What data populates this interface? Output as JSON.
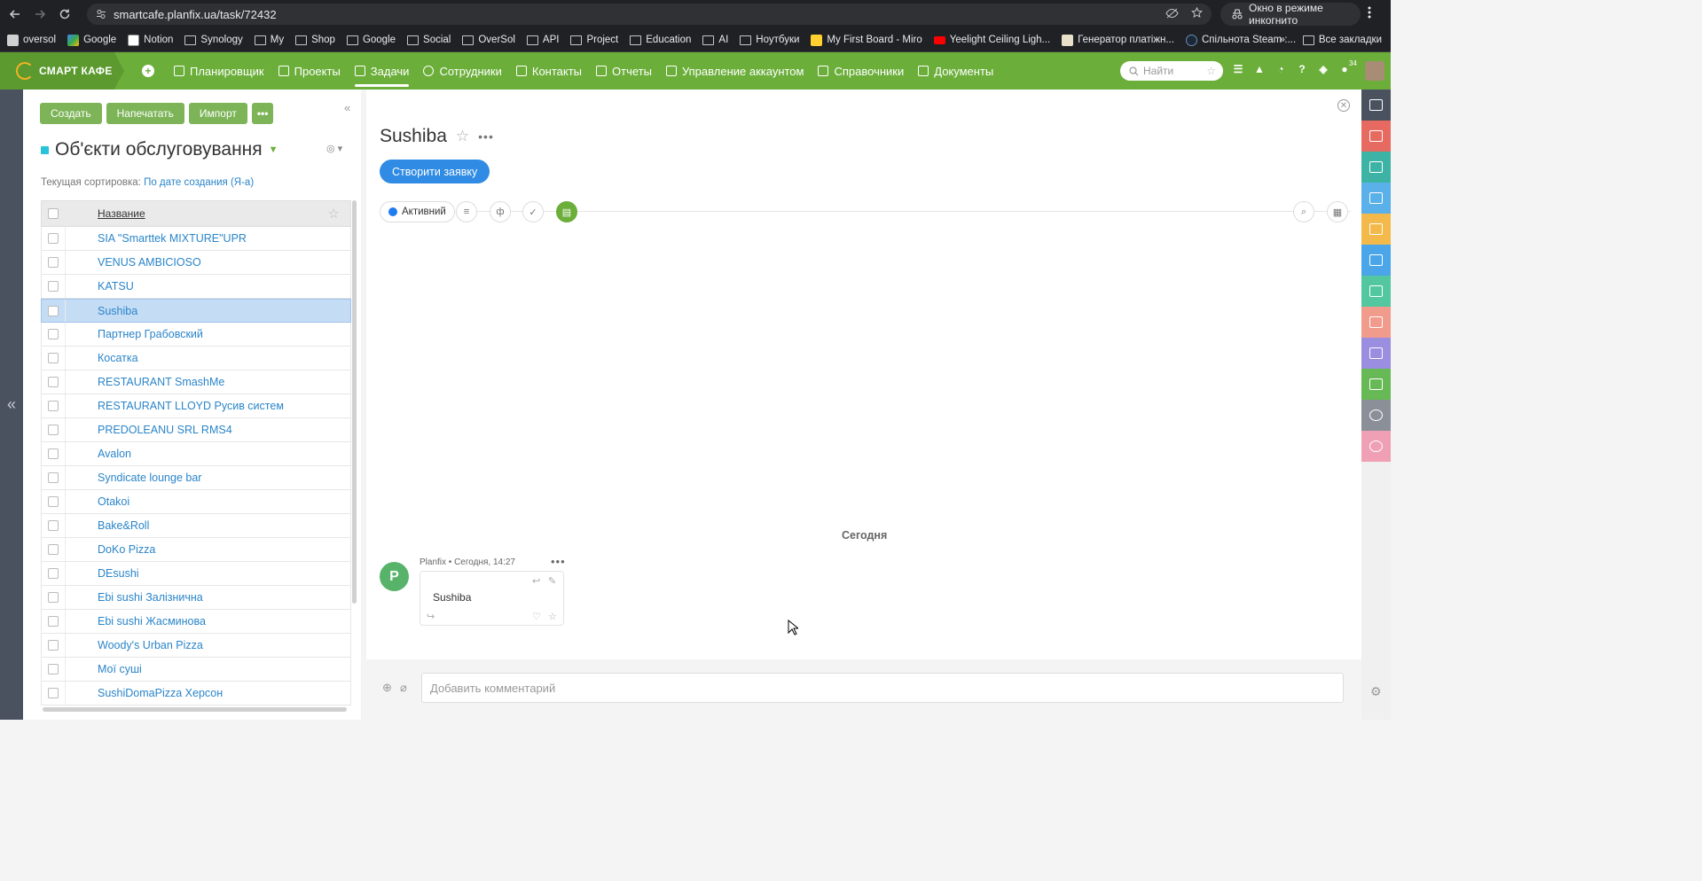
{
  "browser": {
    "url": "smartcafe.planfix.ua/task/72432",
    "incognito_label": "Окно в режиме инкогнито",
    "bookmarks": [
      "oversol",
      "Google",
      "Notion",
      "Synology",
      "My",
      "Shop",
      "Google",
      "Social",
      "OverSol",
      "API",
      "Project",
      "Education",
      "AI",
      "Ноутбуки",
      "My First Board - Miro",
      "Yeelight Ceiling Ligh...",
      "Генератор платіжн...",
      "Спільнота Steam :..."
    ],
    "all_bookmarks": "Все закладки"
  },
  "app": {
    "logo": "СМАРТ КАФЕ",
    "nav": [
      "Планировщик",
      "Проекты",
      "Задачи",
      "Сотрудники",
      "Контакты",
      "Отчеты",
      "Управление аккаунтом",
      "Справочники",
      "Документы"
    ],
    "active_nav": "Задачи",
    "search_placeholder": "Найти",
    "notif_count": "34"
  },
  "list": {
    "buttons": {
      "create": "Создать",
      "print": "Напечатать",
      "import": "Импорт",
      "more": "•••"
    },
    "title": "Об'єкти обслуговування",
    "sort_label": "Текущая сортировка:",
    "sort_value": "По дате создания (Я-а)",
    "column": "Название",
    "rows": [
      "SIA \"Smarttek MIXTURE\"UPR",
      "VENUS AMBICIOSO",
      "KATSU",
      "Sushiba",
      "Партнер Грабовский",
      "Косатка",
      "RESTAURANT SmashMe",
      "RESTAURANT LLOYD Русив систем",
      "PREDOLEANU SRL RMS4",
      "Avalon",
      "Syndicate lounge bar",
      "Otakoi",
      "Bake&Roll",
      "DoKo Pizza",
      "DEsushi",
      "Ebi sushi Залізнична",
      "Ebi sushi Жасминова",
      "Woody's Urban Pizza",
      "Мої суші",
      "SushiDomaPizza Херсон"
    ],
    "selected_row": "Sushiba"
  },
  "task": {
    "title": "Sushiba",
    "create_request": "Створити заявку",
    "status": "Активний",
    "today": "Сегодня",
    "comment_meta": "Planfix • Сегодня, 14:27",
    "comment_text": "Sushiba",
    "comment_placeholder": "Добавить комментарий"
  },
  "colors": {
    "header_green": "#6bae3a",
    "link_blue": "#2a85c9",
    "primary_blue": "#2f8be3",
    "right_bar": [
      "#4a5260",
      "#e66a5f",
      "#3cb3a4",
      "#5ab0e8",
      "#f3b94a",
      "#4aa6e8",
      "#52c7a0",
      "#f09b8c",
      "#9b8de0",
      "#67b955",
      "#8a8f98",
      "#f0a0b5"
    ]
  }
}
